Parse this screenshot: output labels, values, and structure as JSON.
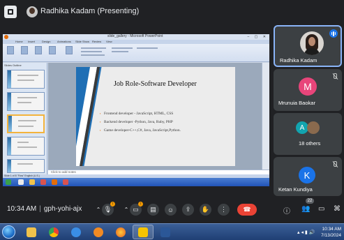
{
  "header": {
    "presenter_name": "Radhika Kadam (Presenting)"
  },
  "shared_screen": {
    "window_title": "slide_gallery - Microsoft PowerPoint",
    "ribbon_tabs": [
      "Home",
      "Insert",
      "Design",
      "Animations",
      "Slide Show",
      "Review",
      "View"
    ],
    "panel_tabs": "Slides  Outline",
    "slide": {
      "title": "Job Role-Software Developer",
      "bullets": [
        "Frontend developer - JavaScript, HTML, CSS",
        "Backend developer -Python, Java, Ruby, PHP",
        "Game developer-C++,C#, Java, JavaScript,Python."
      ]
    },
    "notes_placeholder": "Click to add notes",
    "status_text": "Slide 1 of 8   \"Flow\"   English (U.S.)"
  },
  "participants": [
    {
      "name": "Radhika Kadam",
      "speaking": true,
      "avatar_type": "photo"
    },
    {
      "name": "Mrunuia Baokar",
      "initial": "M",
      "avatar_color": "#e8457a",
      "muted": true
    },
    {
      "name": "18 others",
      "initial": "A",
      "avatar_color": "#12a4af"
    },
    {
      "name": "Ketan Kundiya",
      "initial": "K",
      "avatar_color": "#1a73e8",
      "muted": true
    }
  ],
  "footer": {
    "time": "10:34 AM",
    "meeting_code": "gph-yohi-ajx",
    "people_count": "22"
  },
  "taskbar": {
    "time": "10:34 AM",
    "date": "7/13/2024"
  }
}
